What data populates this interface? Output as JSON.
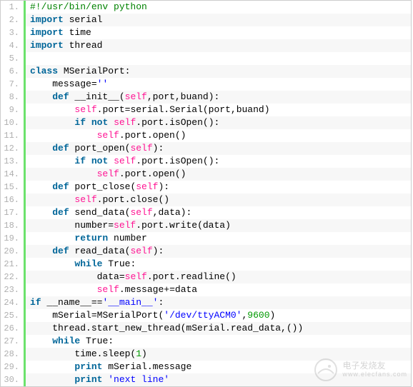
{
  "lines": [
    {
      "n": "1.",
      "tokens": [
        {
          "c": "cm",
          "t": "#!/usr/bin/env python"
        }
      ]
    },
    {
      "n": "2.",
      "tokens": [
        {
          "c": "kw",
          "t": "import"
        },
        {
          "c": "nm",
          "t": " serial"
        }
      ]
    },
    {
      "n": "3.",
      "tokens": [
        {
          "c": "kw",
          "t": "import"
        },
        {
          "c": "nm",
          "t": " time"
        }
      ]
    },
    {
      "n": "4.",
      "tokens": [
        {
          "c": "kw",
          "t": "import"
        },
        {
          "c": "nm",
          "t": " thread"
        }
      ]
    },
    {
      "n": "5.",
      "tokens": []
    },
    {
      "n": "6.",
      "tokens": [
        {
          "c": "kw",
          "t": "class"
        },
        {
          "c": "nm",
          "t": " MSerialPort:"
        }
      ]
    },
    {
      "n": "7.",
      "tokens": [
        {
          "c": "nm",
          "t": "    message"
        },
        {
          "c": "nm",
          "t": "="
        },
        {
          "c": "str",
          "t": "''"
        }
      ]
    },
    {
      "n": "8.",
      "tokens": [
        {
          "c": "nm",
          "t": "    "
        },
        {
          "c": "kw",
          "t": "def"
        },
        {
          "c": "nm",
          "t": " __init__("
        },
        {
          "c": "de",
          "t": "self"
        },
        {
          "c": "nm",
          "t": ",port,buand):"
        }
      ]
    },
    {
      "n": "9.",
      "tokens": [
        {
          "c": "nm",
          "t": "        "
        },
        {
          "c": "de",
          "t": "self"
        },
        {
          "c": "nm",
          "t": ".port"
        },
        {
          "c": "nm",
          "t": "="
        },
        {
          "c": "nm",
          "t": "serial.Serial(port,buand)"
        }
      ]
    },
    {
      "n": "10.",
      "tokens": [
        {
          "c": "nm",
          "t": "        "
        },
        {
          "c": "kw",
          "t": "if"
        },
        {
          "c": "nm",
          "t": " "
        },
        {
          "c": "kw",
          "t": "not"
        },
        {
          "c": "nm",
          "t": " "
        },
        {
          "c": "de",
          "t": "self"
        },
        {
          "c": "nm",
          "t": ".port.isOpen():"
        }
      ]
    },
    {
      "n": "11.",
      "tokens": [
        {
          "c": "nm",
          "t": "            "
        },
        {
          "c": "de",
          "t": "self"
        },
        {
          "c": "nm",
          "t": ".port."
        },
        {
          "c": "nm",
          "t": "open"
        },
        {
          "c": "nm",
          "t": "()"
        }
      ]
    },
    {
      "n": "12.",
      "tokens": [
        {
          "c": "nm",
          "t": "    "
        },
        {
          "c": "kw",
          "t": "def"
        },
        {
          "c": "nm",
          "t": " port_open("
        },
        {
          "c": "de",
          "t": "self"
        },
        {
          "c": "nm",
          "t": "):"
        }
      ]
    },
    {
      "n": "13.",
      "tokens": [
        {
          "c": "nm",
          "t": "        "
        },
        {
          "c": "kw",
          "t": "if"
        },
        {
          "c": "nm",
          "t": " "
        },
        {
          "c": "kw",
          "t": "not"
        },
        {
          "c": "nm",
          "t": " "
        },
        {
          "c": "de",
          "t": "self"
        },
        {
          "c": "nm",
          "t": ".port.isOpen():"
        }
      ]
    },
    {
      "n": "14.",
      "tokens": [
        {
          "c": "nm",
          "t": "            "
        },
        {
          "c": "de",
          "t": "self"
        },
        {
          "c": "nm",
          "t": ".port."
        },
        {
          "c": "nm",
          "t": "open"
        },
        {
          "c": "nm",
          "t": "()"
        }
      ]
    },
    {
      "n": "15.",
      "tokens": [
        {
          "c": "nm",
          "t": "    "
        },
        {
          "c": "kw",
          "t": "def"
        },
        {
          "c": "nm",
          "t": " port_close("
        },
        {
          "c": "de",
          "t": "self"
        },
        {
          "c": "nm",
          "t": "):"
        }
      ]
    },
    {
      "n": "16.",
      "tokens": [
        {
          "c": "nm",
          "t": "        "
        },
        {
          "c": "de",
          "t": "self"
        },
        {
          "c": "nm",
          "t": ".port.close()"
        }
      ]
    },
    {
      "n": "17.",
      "tokens": [
        {
          "c": "nm",
          "t": "    "
        },
        {
          "c": "kw",
          "t": "def"
        },
        {
          "c": "nm",
          "t": " send_data("
        },
        {
          "c": "de",
          "t": "self"
        },
        {
          "c": "nm",
          "t": ",data):"
        }
      ]
    },
    {
      "n": "18.",
      "tokens": [
        {
          "c": "nm",
          "t": "        number"
        },
        {
          "c": "nm",
          "t": "="
        },
        {
          "c": "de",
          "t": "self"
        },
        {
          "c": "nm",
          "t": ".port.write(data)"
        }
      ]
    },
    {
      "n": "19.",
      "tokens": [
        {
          "c": "nm",
          "t": "        "
        },
        {
          "c": "kw",
          "t": "return"
        },
        {
          "c": "nm",
          "t": " number"
        }
      ]
    },
    {
      "n": "20.",
      "tokens": [
        {
          "c": "nm",
          "t": "    "
        },
        {
          "c": "kw",
          "t": "def"
        },
        {
          "c": "nm",
          "t": " read_data("
        },
        {
          "c": "de",
          "t": "self"
        },
        {
          "c": "nm",
          "t": "):"
        }
      ]
    },
    {
      "n": "21.",
      "tokens": [
        {
          "c": "nm",
          "t": "        "
        },
        {
          "c": "kw",
          "t": "while"
        },
        {
          "c": "nm",
          "t": " "
        },
        {
          "c": "nm",
          "t": "True"
        },
        {
          "c": "nm",
          "t": ":"
        }
      ]
    },
    {
      "n": "22.",
      "tokens": [
        {
          "c": "nm",
          "t": "            data"
        },
        {
          "c": "nm",
          "t": "="
        },
        {
          "c": "de",
          "t": "self"
        },
        {
          "c": "nm",
          "t": ".port.readline()"
        }
      ]
    },
    {
      "n": "23.",
      "tokens": [
        {
          "c": "nm",
          "t": "            "
        },
        {
          "c": "de",
          "t": "self"
        },
        {
          "c": "nm",
          "t": ".message"
        },
        {
          "c": "nm",
          "t": "+"
        },
        {
          "c": "nm",
          "t": "="
        },
        {
          "c": "nm",
          "t": "data"
        }
      ]
    },
    {
      "n": "24.",
      "tokens": [
        {
          "c": "kw",
          "t": "if"
        },
        {
          "c": "nm",
          "t": " __name__"
        },
        {
          "c": "nm",
          "t": "="
        },
        {
          "c": "nm",
          "t": "="
        },
        {
          "c": "str",
          "t": "'__main__'"
        },
        {
          "c": "nm",
          "t": ":"
        }
      ]
    },
    {
      "n": "25.",
      "tokens": [
        {
          "c": "nm",
          "t": "    mSerial"
        },
        {
          "c": "nm",
          "t": "="
        },
        {
          "c": "nm",
          "t": "MSerialPort("
        },
        {
          "c": "str",
          "t": "'/dev/ttyACM0'"
        },
        {
          "c": "nm",
          "t": ","
        },
        {
          "c": "num",
          "t": "9600"
        },
        {
          "c": "nm",
          "t": ")"
        }
      ]
    },
    {
      "n": "26.",
      "tokens": [
        {
          "c": "nm",
          "t": "    thread.start_new_thread(mSerial.read_data,())"
        }
      ]
    },
    {
      "n": "27.",
      "tokens": [
        {
          "c": "nm",
          "t": "    "
        },
        {
          "c": "kw",
          "t": "while"
        },
        {
          "c": "nm",
          "t": " "
        },
        {
          "c": "nm",
          "t": "True"
        },
        {
          "c": "nm",
          "t": ":"
        }
      ]
    },
    {
      "n": "28.",
      "tokens": [
        {
          "c": "nm",
          "t": "        time.sleep("
        },
        {
          "c": "num",
          "t": "1"
        },
        {
          "c": "nm",
          "t": ")"
        }
      ]
    },
    {
      "n": "29.",
      "tokens": [
        {
          "c": "nm",
          "t": "        "
        },
        {
          "c": "kw",
          "t": "print"
        },
        {
          "c": "nm",
          "t": " mSerial.message"
        }
      ]
    },
    {
      "n": "30.",
      "tokens": [
        {
          "c": "nm",
          "t": "        "
        },
        {
          "c": "kw",
          "t": "print"
        },
        {
          "c": "nm",
          "t": " "
        },
        {
          "c": "str",
          "t": "'next line'"
        }
      ]
    }
  ],
  "watermark": {
    "brand": "电子发烧友",
    "site": "www.elecfans.com"
  }
}
